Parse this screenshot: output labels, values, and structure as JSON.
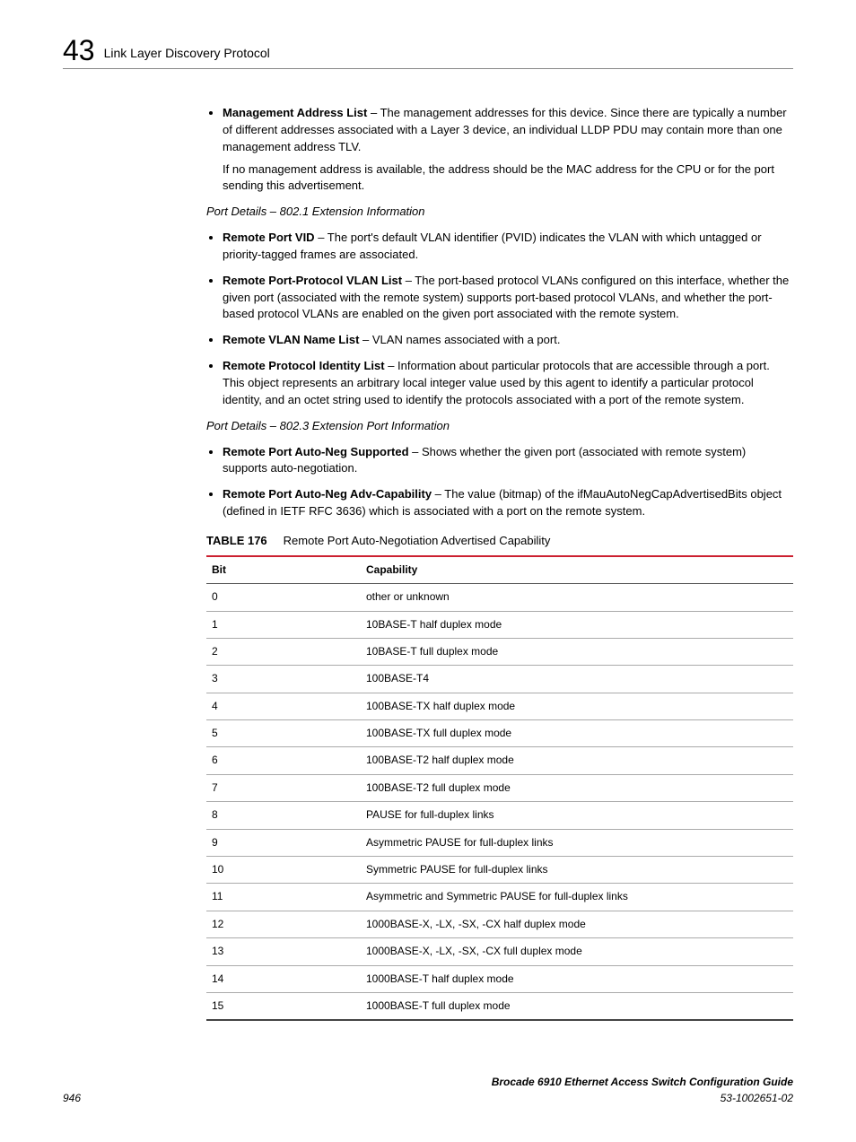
{
  "header": {
    "chapter_num": "43",
    "chapter_title": "Link Layer Discovery Protocol"
  },
  "body": {
    "mgmt_addr": {
      "label": "Management Address List",
      "text": " – The management addresses for this device. Since there are typically a number of different addresses associated with a Layer 3 device, an individual LLDP PDU may contain more than one management address TLV.",
      "subtext": "If no management address is available, the address should be the MAC address for the CPU or for the port sending this advertisement."
    },
    "heading_8021": "Port Details – 802.1 Extension Information",
    "remote_port_vid": {
      "label": "Remote Port VID",
      "text": " – The port's default VLAN identifier (PVID) indicates the VLAN with which untagged or priority-tagged frames are associated."
    },
    "remote_port_proto_vlan": {
      "label": "Remote Port-Protocol VLAN List",
      "text": " – The port-based protocol VLANs configured on this interface, whether the given port (associated with the remote system) supports port-based protocol VLANs, and whether the port-based protocol VLANs are enabled on the given port associated with the remote system."
    },
    "remote_vlan_name": {
      "label": "Remote VLAN Name List",
      "text": " – VLAN names associated with a port."
    },
    "remote_proto_identity": {
      "label": "Remote Protocol Identity List",
      "text": " – Information about particular protocols that are accessible through a port. This object represents an arbitrary local integer value used by this agent to identify a particular protocol identity, and an octet string used to identify the protocols associated with a port of the remote system."
    },
    "heading_8023": "Port Details – 802.3 Extension Port Information",
    "remote_autoneg_supported": {
      "label": "Remote Port Auto-Neg Supported",
      "text": " – Shows whether the given port (associated with remote system) supports auto-negotiation."
    },
    "remote_autoneg_adv": {
      "label": "Remote Port Auto-Neg Adv-Capability",
      "text": " – The value (bitmap) of the ifMauAutoNegCapAdvertisedBits object (defined in IETF RFC 3636) which is associated with a port on the remote system."
    }
  },
  "table": {
    "caption_label": "TABLE 176",
    "caption_text": "Remote Port Auto-Negotiation Advertised Capability",
    "headers": {
      "bit": "Bit",
      "cap": "Capability"
    },
    "rows": [
      {
        "bit": "0",
        "cap": "other or unknown"
      },
      {
        "bit": "1",
        "cap": "10BASE-T half duplex mode"
      },
      {
        "bit": "2",
        "cap": "10BASE-T full duplex mode"
      },
      {
        "bit": "3",
        "cap": "100BASE-T4"
      },
      {
        "bit": "4",
        "cap": "100BASE-TX half duplex mode"
      },
      {
        "bit": "5",
        "cap": "100BASE-TX full duplex mode"
      },
      {
        "bit": "6",
        "cap": "100BASE-T2 half duplex mode"
      },
      {
        "bit": "7",
        "cap": "100BASE-T2 full duplex mode"
      },
      {
        "bit": "8",
        "cap": "PAUSE for full-duplex links"
      },
      {
        "bit": "9",
        "cap": "Asymmetric PAUSE for full-duplex links"
      },
      {
        "bit": "10",
        "cap": "Symmetric PAUSE for full-duplex links"
      },
      {
        "bit": "11",
        "cap": "Asymmetric and Symmetric PAUSE for full-duplex links"
      },
      {
        "bit": "12",
        "cap": "1000BASE-X, -LX, -SX, -CX half duplex mode"
      },
      {
        "bit": "13",
        "cap": "1000BASE-X, -LX, -SX, -CX full duplex mode"
      },
      {
        "bit": "14",
        "cap": "1000BASE-T half duplex mode"
      },
      {
        "bit": "15",
        "cap": "1000BASE-T full duplex mode"
      }
    ]
  },
  "footer": {
    "page": "946",
    "doc_title": "Brocade 6910 Ethernet Access Switch Configuration Guide",
    "doc_num": "53-1002651-02"
  }
}
